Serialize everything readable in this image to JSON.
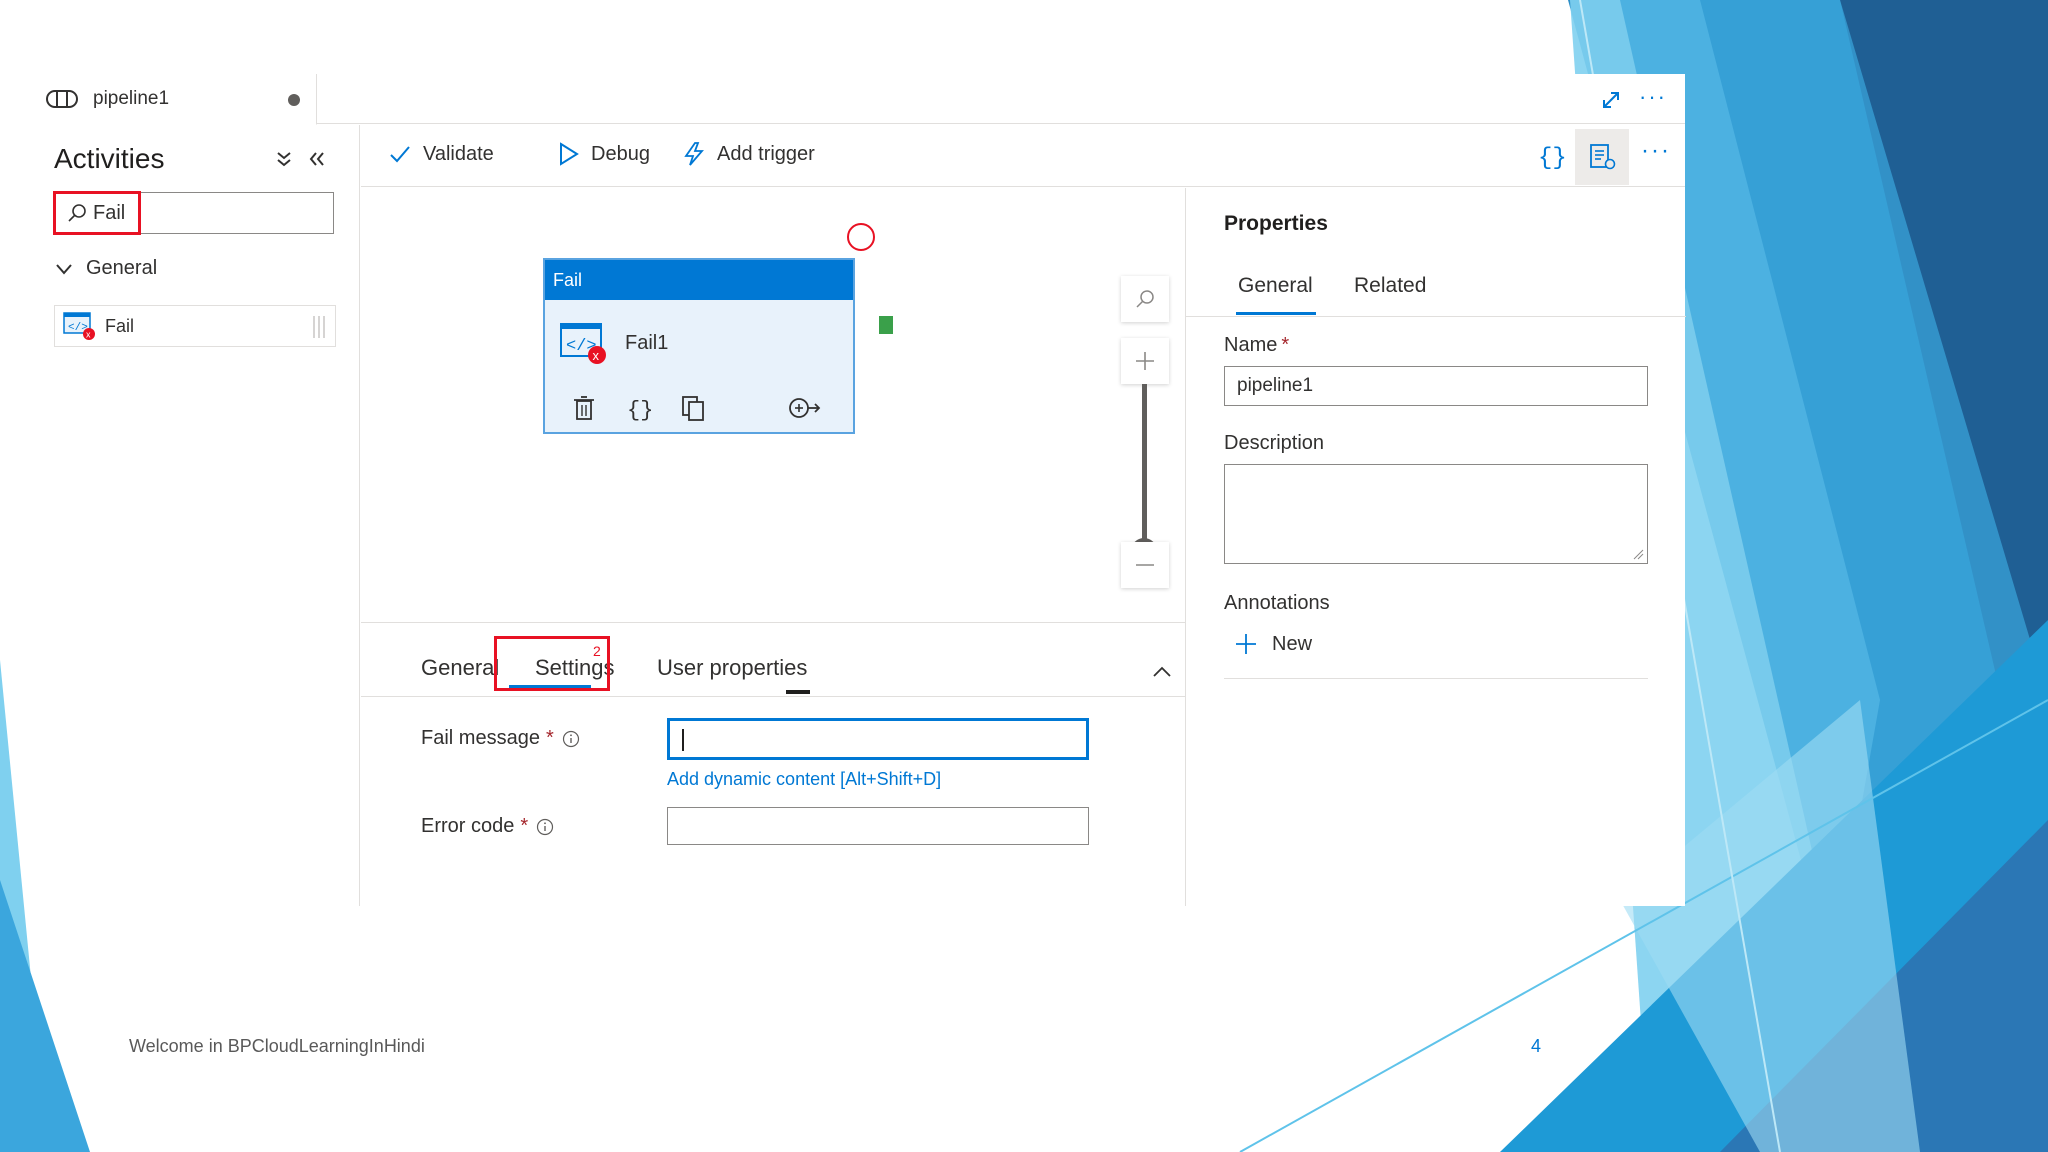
{
  "pipeline_tab": {
    "title": "pipeline1"
  },
  "activities": {
    "title": "Activities",
    "search_value": "Fail",
    "group": "General",
    "items": [
      {
        "label": "Fail"
      }
    ]
  },
  "toolbar": {
    "validate": "Validate",
    "debug": "Debug",
    "add_trigger": "Add trigger"
  },
  "canvas": {
    "node": {
      "type_label": "Fail",
      "name": "Fail1"
    }
  },
  "bottom_panel": {
    "tabs": [
      "General",
      "Settings",
      "User properties"
    ],
    "active_tab": "Settings",
    "settings_badge": "2",
    "fail_message_label": "Fail message",
    "required_mark": "*",
    "dynamic_content_link": "Add dynamic content [Alt+Shift+D]",
    "error_code_label": "Error code"
  },
  "properties": {
    "title": "Properties",
    "tabs": [
      "General",
      "Related"
    ],
    "active_tab": "General",
    "name_label": "Name",
    "name_value": "pipeline1",
    "description_label": "Description",
    "annotations_label": "Annotations",
    "new_button": "New"
  },
  "slide": {
    "footer": "Welcome in BPCloudLearningInHindi",
    "page_number": "4"
  },
  "colors": {
    "accent": "#0078d4",
    "highlight": "#e81123",
    "node_header": "#0078d4",
    "success_port": "#3aa04a"
  }
}
